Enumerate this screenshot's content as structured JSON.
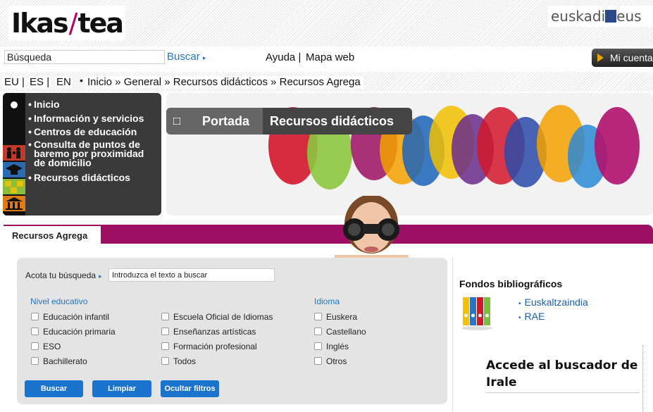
{
  "header": {
    "logo_text_left": "Ikas",
    "logo_text_right": "tea",
    "euskadi_text_left": "euskadi",
    "euskadi_text_right": "eus"
  },
  "topbar": {
    "search_value": "Búsqueda",
    "search_button": "Buscar",
    "help": "Ayuda",
    "separator": "|",
    "sitemap": "Mapa web",
    "account": "Mi cuenta"
  },
  "languages": [
    {
      "label": "EU"
    },
    {
      "label": "ES"
    },
    {
      "label": "EN"
    }
  ],
  "breadcrumb": "Inicio » General » Recursos didácticos » Recursos Agrega",
  "sidenav": {
    "items": [
      {
        "label": "Inicio"
      },
      {
        "label": "Información y servicios"
      },
      {
        "label": "Centros de educación"
      },
      {
        "label": "Consulta de puntos de baremo por proximidad de domicilio"
      },
      {
        "label": "Recursos didácticos"
      }
    ]
  },
  "banner": {
    "tab_portada": "Portada",
    "tab_recursos": "Recursos didácticos"
  },
  "main": {
    "tab_label": "Recursos Agrega",
    "filter_label": "Acota tu búsqueda",
    "filter_value": "Introduzca el texto a buscar",
    "nivel_title": "Nivel educativo",
    "idioma_title": "Idioma",
    "nivel_col1": [
      "Educación infantil",
      "Educación primaria",
      "ESO",
      "Bachillerato"
    ],
    "nivel_col2": [
      "Escuela Oficial de Idiomas",
      "Enseñanzas artísticas",
      "Formación profesional",
      "Todos"
    ],
    "idiomas": [
      "Euskera",
      "Castellano",
      "Inglés",
      "Otros"
    ],
    "btn_buscar": "Buscar",
    "btn_limpiar": "Limpiar",
    "btn_ocultar": "Ocultar filtros"
  },
  "aside": {
    "fondos_title": "Fondos bibliográficos",
    "links": [
      "Euskaltzaindia",
      "RAE"
    ],
    "irale": "Accede al buscador de Irale"
  },
  "colors": {
    "brand_magenta": "#9c0f63",
    "link_blue": "#1f5fa8",
    "button_blue": "#1a73cc"
  }
}
